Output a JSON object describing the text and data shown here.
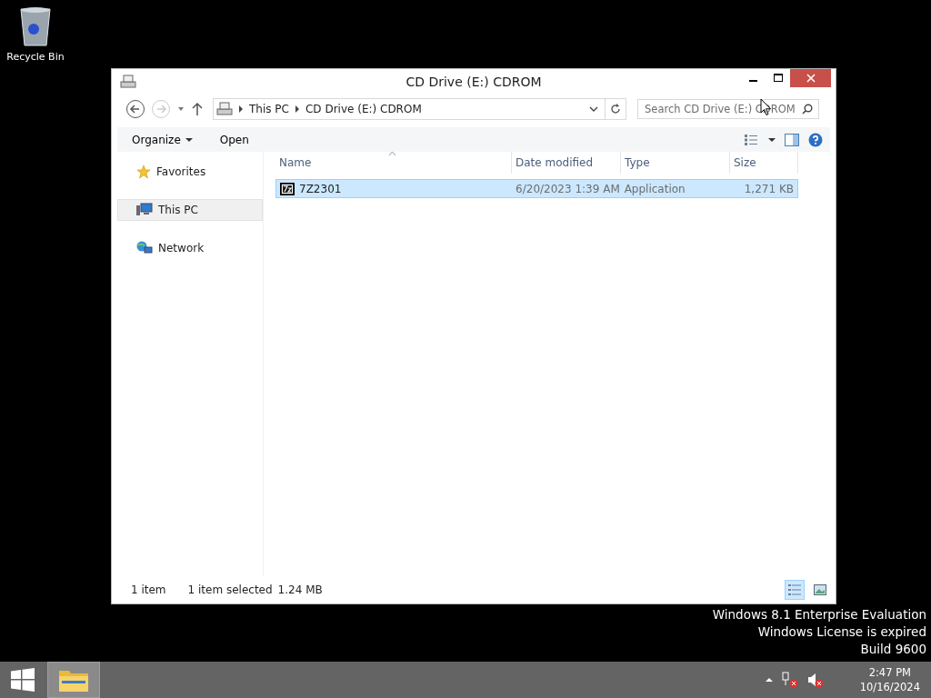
{
  "desktop": {
    "icons": [
      {
        "label": "Recycle Bin"
      }
    ],
    "watermark": [
      "Windows 8.1 Enterprise Evaluation",
      "Windows License is expired",
      "Build 9600"
    ]
  },
  "window": {
    "title": "CD Drive (E:) CDROM",
    "address": {
      "crumbs": [
        "This PC",
        "CD Drive (E:) CDROM"
      ]
    },
    "search": {
      "placeholder": "Search CD Drive (E:) CDROM"
    },
    "toolbar": [
      {
        "label": "Organize",
        "dropdown": true
      },
      {
        "label": "Open",
        "dropdown": false
      }
    ],
    "nav": [
      {
        "label": "Favorites",
        "kind": "favorites",
        "selected": false
      },
      {
        "label": "This PC",
        "kind": "computer",
        "selected": true
      },
      {
        "label": "Network",
        "kind": "network",
        "selected": false
      }
    ],
    "columns": [
      "Name",
      "Date modified",
      "Type",
      "Size"
    ],
    "rows": [
      {
        "name": "7Z2301",
        "date": "6/20/2023 1:39 AM",
        "type": "Application",
        "size": "1,271 KB",
        "selected": true
      }
    ],
    "status": {
      "count": "1 item",
      "selection": "1 item selected",
      "size": "1.24 MB"
    },
    "views": [
      {
        "kind": "details",
        "selected": true
      },
      {
        "kind": "tiles",
        "selected": false
      }
    ]
  },
  "taskbar": {
    "time": "2:47 PM",
    "date": "10/16/2024"
  }
}
